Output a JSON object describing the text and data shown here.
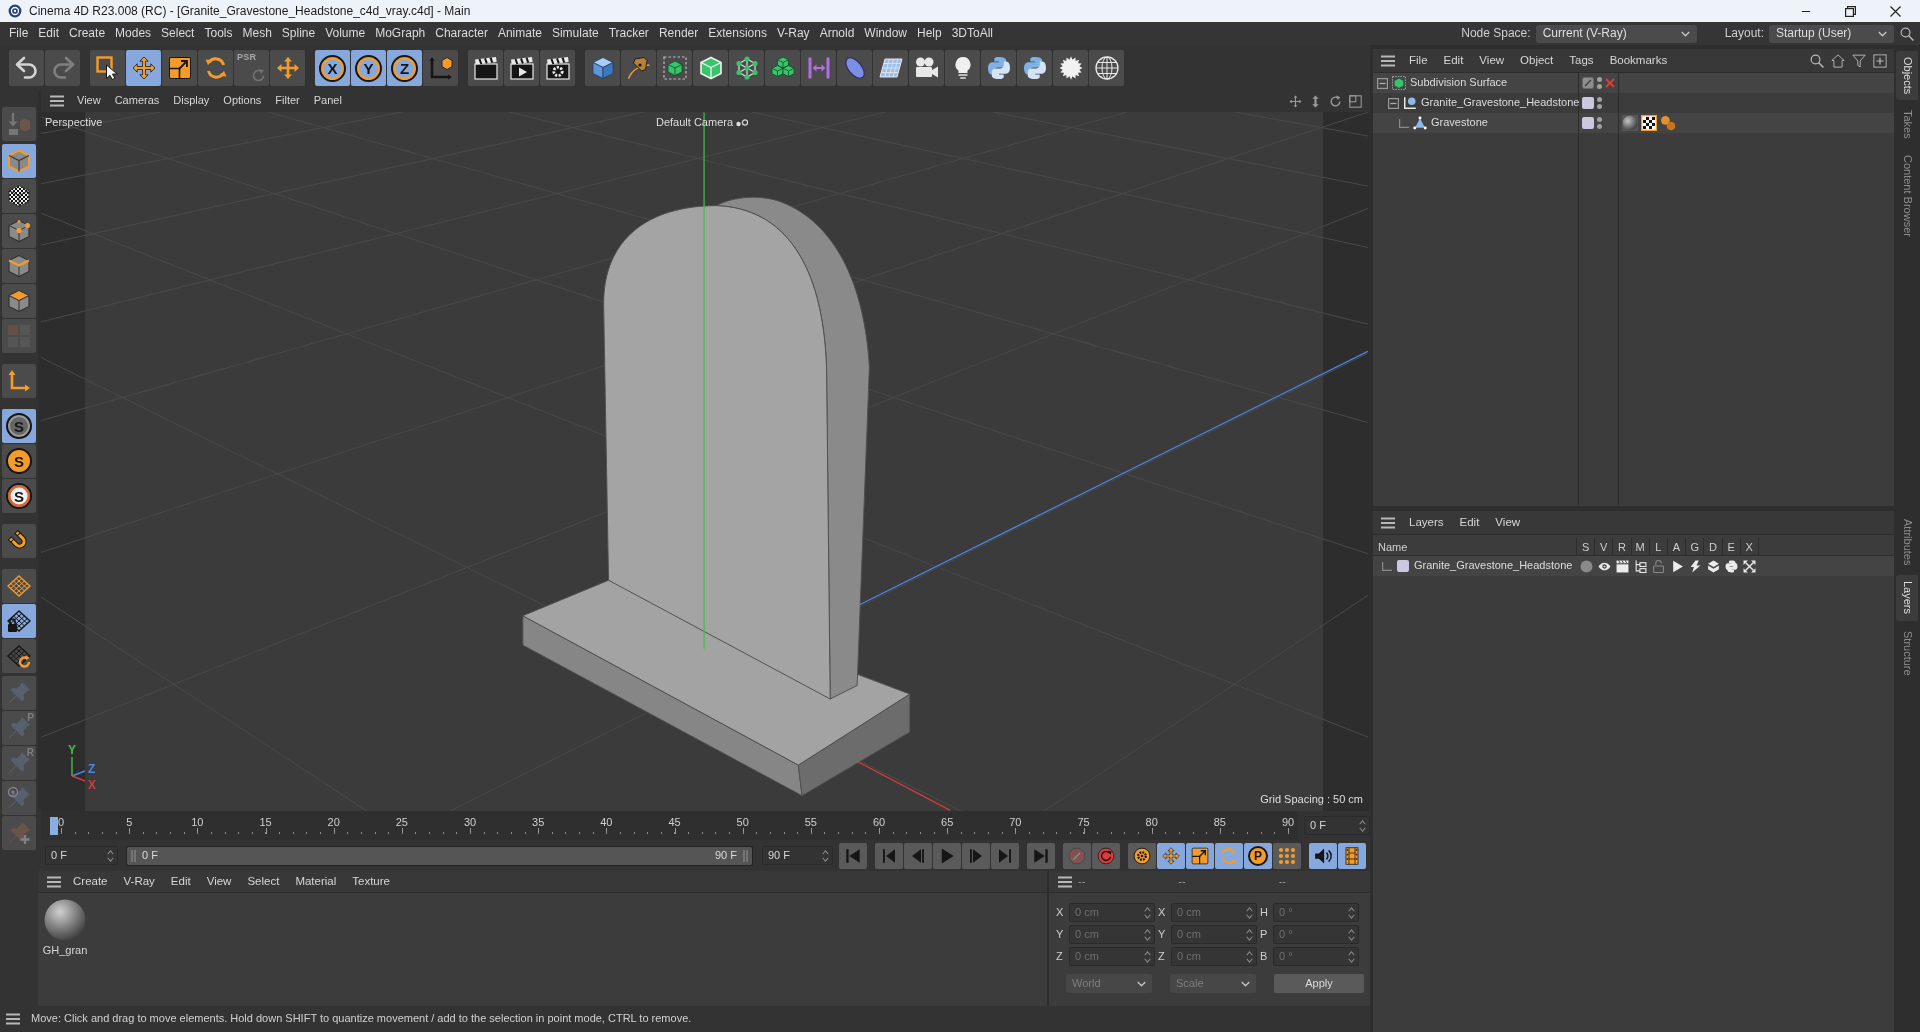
{
  "window": {
    "title": "Cinema 4D R23.008 (RC) - [Granite_Gravestone_Headstone_c4d_vray.c4d] - Main"
  },
  "menu_bar": {
    "items": [
      "File",
      "Edit",
      "Create",
      "Modes",
      "Select",
      "Tools",
      "Mesh",
      "Spline",
      "Volume",
      "MoGraph",
      "Character",
      "Animate",
      "Simulate",
      "Tracker",
      "Render",
      "Extensions",
      "V-Ray",
      "Arnold",
      "Window",
      "Help",
      "3DToAll"
    ],
    "node_space": {
      "label": "Node Space:",
      "value": "Current (V-Ray)"
    },
    "layout": {
      "label": "Layout:",
      "value": "Startup (User)"
    }
  },
  "toolbar": {
    "groups": [
      [
        {
          "kind": "undo",
          "selected": false,
          "disabled": false
        },
        {
          "kind": "redo",
          "selected": false,
          "disabled": true
        }
      ],
      [
        {
          "kind": "select",
          "selected": false,
          "disabled": false
        },
        {
          "kind": "move",
          "selected": true,
          "disabled": false
        },
        {
          "kind": "scale",
          "selected": false,
          "disabled": false
        },
        {
          "kind": "rotate",
          "selected": false,
          "disabled": false
        },
        {
          "kind": "psr",
          "label": "PSR",
          "selected": false,
          "disabled": true
        },
        {
          "kind": "transform",
          "selected": false,
          "disabled": false
        }
      ],
      [
        {
          "kind": "axis-lock",
          "label": "X",
          "selected": true,
          "disabled": false
        },
        {
          "kind": "axis-lock",
          "label": "Y",
          "selected": true,
          "disabled": false
        },
        {
          "kind": "axis-lock",
          "label": "Z",
          "selected": true,
          "disabled": false
        },
        {
          "kind": "coord-system",
          "selected": false,
          "disabled": false
        }
      ],
      [
        {
          "kind": "render-view",
          "selected": false,
          "disabled": false
        },
        {
          "kind": "render",
          "selected": false,
          "disabled": false
        },
        {
          "kind": "render-settings",
          "selected": false,
          "disabled": false
        }
      ],
      [
        {
          "kind": "cube",
          "selected": false,
          "disabled": false
        },
        {
          "kind": "pen",
          "selected": false,
          "disabled": false
        },
        {
          "kind": "subdivision",
          "selected": false,
          "disabled": false
        },
        {
          "kind": "extrude",
          "selected": false,
          "disabled": false
        },
        {
          "kind": "cloner",
          "selected": false,
          "disabled": false
        },
        {
          "kind": "array",
          "selected": false,
          "disabled": false
        },
        {
          "kind": "symmetry",
          "selected": false,
          "disabled": false
        },
        {
          "kind": "bend",
          "selected": false,
          "disabled": false
        },
        {
          "kind": "floor",
          "selected": false,
          "disabled": false
        },
        {
          "kind": "camera",
          "selected": false,
          "disabled": false
        },
        {
          "kind": "light",
          "selected": false,
          "disabled": false
        },
        {
          "kind": "python",
          "selected": false,
          "disabled": false
        },
        {
          "kind": "python",
          "selected": false,
          "disabled": false
        },
        {
          "kind": "starburst",
          "selected": false,
          "disabled": false
        },
        {
          "kind": "globe",
          "selected": false,
          "disabled": false
        }
      ]
    ]
  },
  "tool_palette": {
    "groups": [
      [
        {
          "kind": "make-editable",
          "selected": false,
          "disabled": true
        }
      ],
      [
        {
          "kind": "model-mode",
          "selected": true,
          "disabled": false
        },
        {
          "kind": "texture-mode",
          "selected": false,
          "disabled": false
        },
        {
          "kind": "points-mode",
          "selected": false,
          "disabled": false
        },
        {
          "kind": "edges-mode",
          "selected": false,
          "disabled": false
        },
        {
          "kind": "polygons-mode",
          "selected": false,
          "disabled": false
        },
        {
          "kind": "uv-mode",
          "selected": false,
          "disabled": true
        }
      ],
      [
        {
          "kind": "axis-mode",
          "selected": false,
          "disabled": false
        }
      ],
      [
        {
          "kind": "snap",
          "label": "S",
          "selected": true,
          "disabled": false
        },
        {
          "kind": "snap-filled",
          "label": "S",
          "selected": false,
          "disabled": false
        },
        {
          "kind": "snap-ring",
          "label": "S",
          "selected": false,
          "disabled": false
        }
      ],
      [
        {
          "kind": "magnet",
          "selected": false,
          "disabled": false
        }
      ],
      [
        {
          "kind": "workplane",
          "selected": false,
          "disabled": false
        },
        {
          "kind": "grid-lock",
          "selected": true,
          "disabled": false
        },
        {
          "kind": "grid-rotate",
          "selected": false,
          "disabled": false
        }
      ],
      [
        {
          "kind": "pin",
          "selected": false,
          "disabled": true
        },
        {
          "kind": "pin",
          "label": "P",
          "selected": false,
          "disabled": true
        },
        {
          "kind": "pin",
          "label": "R",
          "selected": false,
          "disabled": true
        },
        {
          "kind": "pin-target",
          "selected": false,
          "disabled": true
        },
        {
          "kind": "pin-plus",
          "selected": false,
          "disabled": true
        }
      ]
    ]
  },
  "viewport": {
    "menu": [
      "View",
      "Cameras",
      "Display",
      "Options",
      "Filter",
      "Panel"
    ],
    "view_name": "Perspective",
    "camera": "Default Camera",
    "grid_spacing": "Grid Spacing : 50 cm",
    "axes": [
      {
        "label": "Y",
        "color": "#3fc23f"
      },
      {
        "label": "Z",
        "color": "#4a86e8"
      },
      {
        "label": "X",
        "color": "#d23c3c"
      }
    ]
  },
  "timeline": {
    "ticks": [
      "0",
      "5",
      "10",
      "15",
      "20",
      "25",
      "30",
      "35",
      "40",
      "45",
      "50",
      "55",
      "60",
      "65",
      "70",
      "75",
      "80",
      "85",
      "90"
    ],
    "level": 0,
    "current_frame": "0 F",
    "start": "0 F",
    "range": {
      "start": "0 F",
      "end": "90 F",
      "level": 1
    },
    "end": "90 F",
    "controls": [
      [
        {
          "kind": "go-start",
          "selected": false,
          "disabled": false
        }
      ],
      [
        {
          "kind": "prev-key",
          "selected": false,
          "disabled": false
        },
        {
          "kind": "prev-frame",
          "selected": false,
          "disabled": false
        },
        {
          "kind": "play",
          "selected": false,
          "disabled": false
        },
        {
          "kind": "next-frame",
          "selected": false,
          "disabled": false
        },
        {
          "kind": "next-key",
          "selected": false,
          "disabled": false
        }
      ],
      [
        {
          "kind": "go-end",
          "selected": false,
          "disabled": false
        }
      ],
      [
        {
          "kind": "record",
          "selected": false,
          "disabled": true
        },
        {
          "kind": "autokey",
          "selected": false,
          "disabled": false
        }
      ],
      [
        {
          "kind": "key-gear",
          "selected": false,
          "disabled": false
        },
        {
          "kind": "key-move",
          "selected": true,
          "disabled": false
        },
        {
          "kind": "key-scale",
          "selected": true,
          "disabled": false
        },
        {
          "kind": "key-rotate",
          "selected": true,
          "disabled": false
        },
        {
          "kind": "key-param",
          "label": "P",
          "selected": true,
          "disabled": false
        },
        {
          "kind": "key-points",
          "selected": false,
          "disabled": false
        }
      ],
      [
        {
          "kind": "sound",
          "selected": true,
          "disabled": false
        },
        {
          "kind": "film",
          "selected": true,
          "disabled": false
        }
      ]
    ]
  },
  "material_manager": {
    "menu": [
      "Create",
      "V-Ray",
      "Edit",
      "View",
      "Select",
      "Material",
      "Texture"
    ],
    "materials": [
      {
        "name": "GH_gran"
      }
    ]
  },
  "coordinates": {
    "headers": [
      "--",
      "--",
      "--"
    ],
    "disabled": true,
    "rows": [
      {
        "position_axis": "X",
        "position": "0 cm",
        "size_axis": "X",
        "size": "0 cm",
        "rotation_axis": "H",
        "rotation": "0 °"
      },
      {
        "position_axis": "Y",
        "position": "0 cm",
        "size_axis": "Y",
        "size": "0 cm",
        "rotation_axis": "P",
        "rotation": "0 °"
      },
      {
        "position_axis": "Z",
        "position": "0 cm",
        "size_axis": "Z",
        "size": "0 cm",
        "rotation_axis": "B",
        "rotation": "0 °"
      }
    ],
    "mode": "World",
    "size_mode": "Scale",
    "apply": "Apply"
  },
  "status_bar": {
    "text": "Move: Click and drag to move elements. Hold down SHIFT to quantize movement / add to the selection in point mode, CTRL to remove."
  },
  "object_manager": {
    "menu": [
      "File",
      "Edit",
      "View",
      "Object",
      "Tags",
      "Bookmarks"
    ],
    "objects": [
      {
        "name": "Subdivision Surface",
        "kind": "generator",
        "expanded": true,
        "enabled": false,
        "children": [
          {
            "name": "Granite_Gravestone_Headstone",
            "kind": "null",
            "expanded": true,
            "color": "#cbc7e0",
            "children": [
              {
                "name": "Gravestone",
                "kind": "polygon",
                "color": "#cbc7e0",
                "tags": [
                  {
                    "kind": "material"
                  },
                  {
                    "kind": "uvw"
                  },
                  {
                    "kind": "vertex"
                  }
                ]
              }
            ]
          }
        ]
      }
    ]
  },
  "layer_manager": {
    "menu": [
      "Layers",
      "Edit",
      "View"
    ],
    "columns": [
      "Name",
      "S",
      "V",
      "R",
      "M",
      "L",
      "A",
      "G",
      "D",
      "E",
      "X"
    ],
    "layers": [
      {
        "name": "Granite_Gravestone_Headstone",
        "color": "#cbc7e0",
        "solo": false,
        "visible": true,
        "render": true,
        "manager": true,
        "locked": false,
        "animation": true,
        "generators": true,
        "deformers": true,
        "expressions": true,
        "xref": true
      }
    ]
  },
  "side_tabs": {
    "upper": [
      {
        "label": "Objects",
        "selected": true
      },
      {
        "label": "Takes",
        "selected": false
      },
      {
        "label": "Content Browser",
        "selected": false
      }
    ],
    "lower": [
      {
        "label": "Attributes",
        "selected": false
      },
      {
        "label": "Layers",
        "selected": true
      },
      {
        "label": "Structure",
        "selected": false
      }
    ]
  }
}
